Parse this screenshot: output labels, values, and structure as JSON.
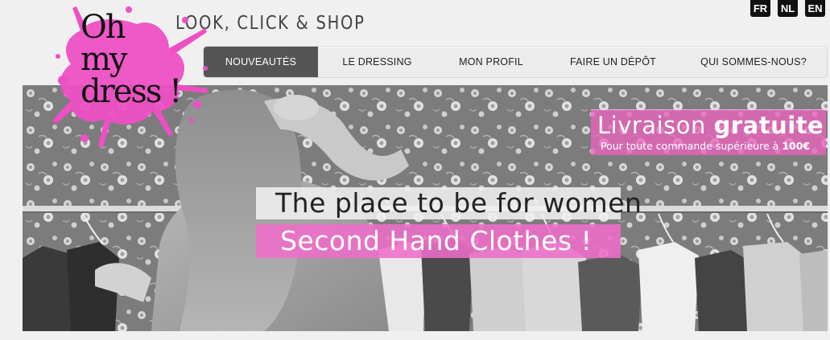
{
  "logo": {
    "lines": [
      "Oh",
      "my",
      "dress !"
    ],
    "splash_color": "#ee4fc4"
  },
  "tagline": "LOOK, CLICK & SHOP",
  "languages": [
    "FR",
    "NL",
    "EN"
  ],
  "nav": {
    "items": [
      {
        "label": "NOUVEAUTÉS",
        "active": true
      },
      {
        "label": "LE DRESSING",
        "active": false
      },
      {
        "label": "MON PROFIL",
        "active": false
      },
      {
        "label": "FAIRE UN DÉPÔT",
        "active": false
      },
      {
        "label": "QUI SOMMES-NOUS?",
        "active": false
      }
    ]
  },
  "hero": {
    "promo": {
      "title_light": "Livraison",
      "title_bold": "gratuite",
      "subtitle": "Pour toute commande supérieure à",
      "amount": "100€"
    },
    "headline": "The place to be for women",
    "subheadline": "Second Hand Clothes !"
  },
  "colors": {
    "accent_pink": "#ee6ec8",
    "nav_active": "#555555",
    "page_bg": "#f0f0f0"
  }
}
